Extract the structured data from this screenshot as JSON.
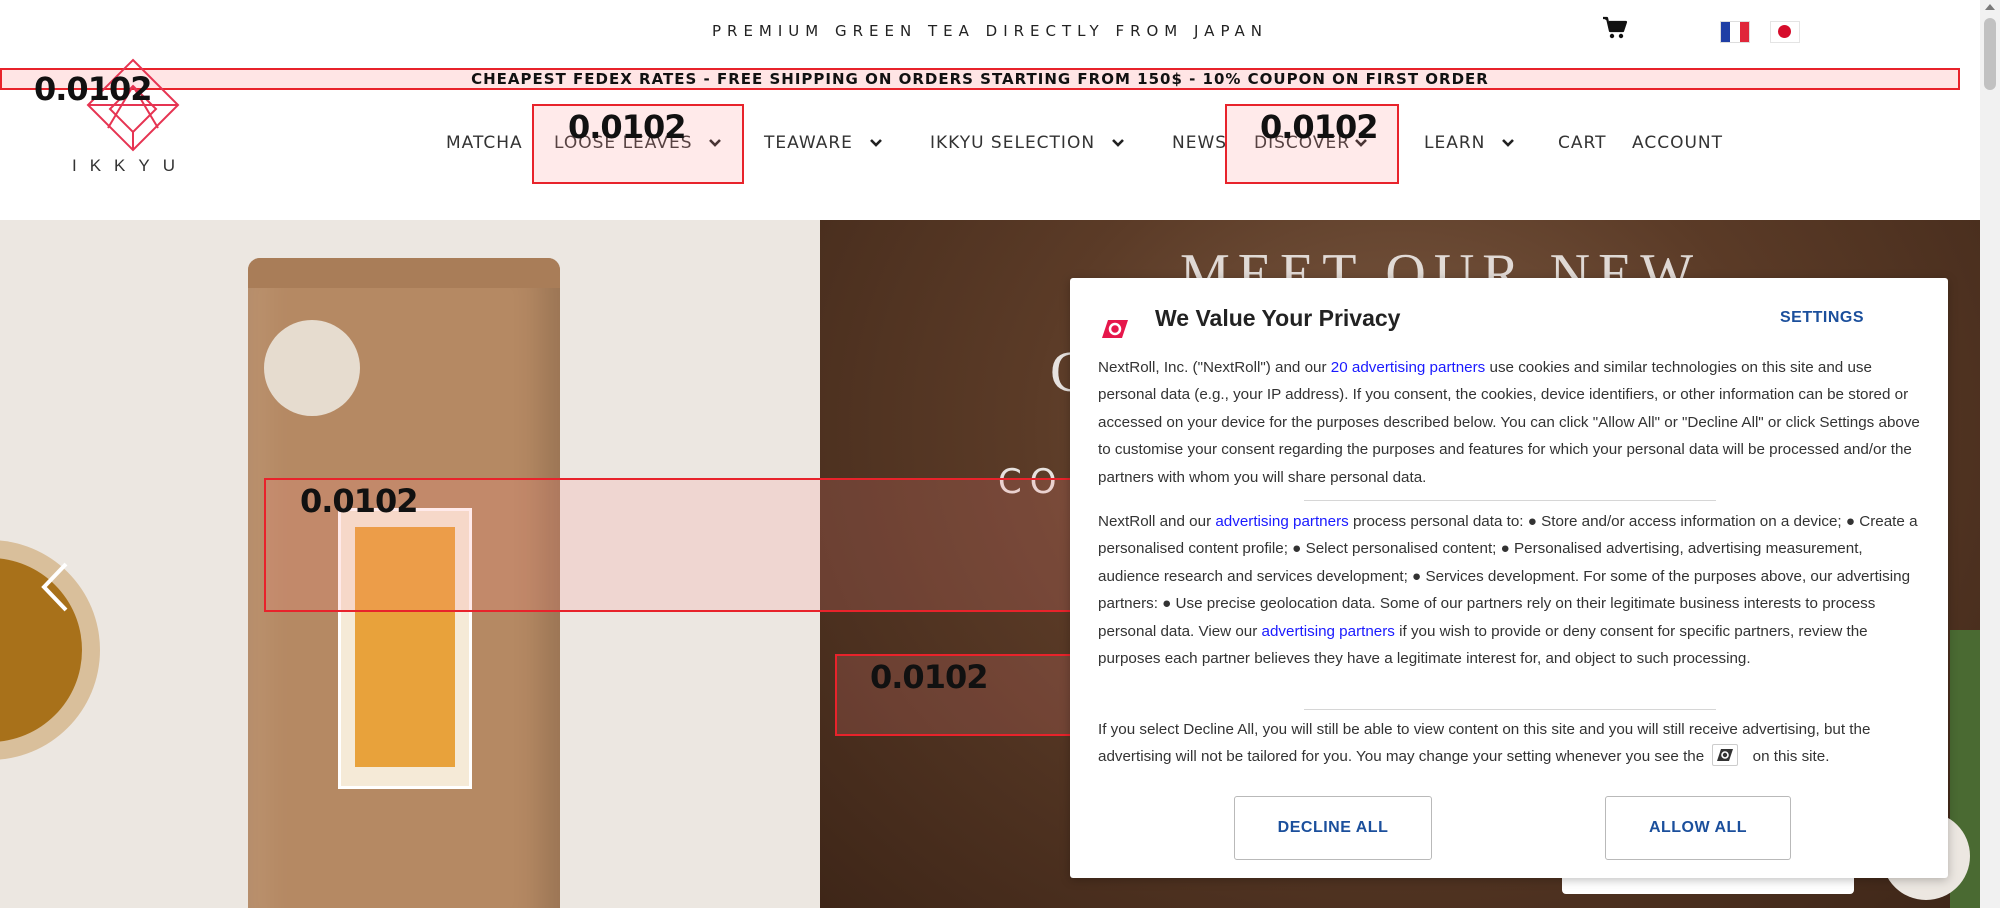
{
  "header": {
    "tagline": "PREMIUM GREEN TEA DIRECTLY FROM JAPAN",
    "cart_icon": "shopping-cart-icon",
    "languages": [
      "fr-flag",
      "jp-flag"
    ],
    "promo": "CHEAPEST FEDEX RATES - FREE SHIPPING ON ORDERS STARTING FROM 150$ - 10% COUPON ON FIRST ORDER",
    "logo_text": "IKKYU"
  },
  "nav": {
    "items": [
      {
        "label": "MATCHA",
        "dropdown": false
      },
      {
        "label": "LOOSE LEAVES",
        "dropdown": true
      },
      {
        "label": "TEAWARE",
        "dropdown": true
      },
      {
        "label": "IKKYU SELECTION",
        "dropdown": true
      },
      {
        "label": "NEWS",
        "dropdown": false
      },
      {
        "label": "DISCOVER",
        "dropdown": true
      },
      {
        "label": "LEARN",
        "dropdown": true
      },
      {
        "label": "CART",
        "dropdown": false
      },
      {
        "label": "ACCOUNT",
        "dropdown": false
      }
    ]
  },
  "overlay_labels": {
    "logo": "0.0102",
    "loose_leaves": "0.0102",
    "discover": "0.0102",
    "hero_left": "0.0102",
    "hero_center": "0.0102"
  },
  "hero": {
    "heading": "MEET OUR NEW",
    "line2_initial": "C",
    "subline": "CO",
    "prev_icon": "chevron-left-icon"
  },
  "privacy": {
    "title": "We Value Your Privacy",
    "settings_label": "SETTINGS",
    "para1": {
      "pre": "NextRoll, Inc. (\"NextRoll\") and our ",
      "link": "20 advertising partners",
      "post": " use cookies and similar technologies on this site and use personal data (e.g., your IP address). If you consent, the cookies, device identifiers, or other information can be stored or accessed on your device for the purposes described below. You can click \"Allow All\" or \"Decline All\" or click Settings above to customise your consent regarding the purposes and features for which your personal data will be processed and/or the partners with whom you will share personal data."
    },
    "para2": {
      "pre": "NextRoll and our ",
      "link1": "advertising partners",
      "mid": " process personal data to: ● Store and/or access information on a device; ● Create a personalised content profile; ● Select personalised content; ● Personalised advertising, advertising measurement, audience research and services development; ● Services development. For some of the purposes above, our advertising partners: ● Use precise geolocation data. Some of our partners rely on their legitimate business interests to process personal data. View our ",
      "link2": "advertising partners",
      "post": " if you wish to provide or deny consent for specific partners, review the purposes each partner believes they have a legitimate interest for, and object to such processing."
    },
    "para3": {
      "pre": "If you select Decline All, you will still be able to view content on this site and you will still receive advertising, but the advertising will not be tailored for you. You may change your setting whenever you see the ",
      "post": " on this site."
    },
    "decline_label": "DECLINE ALL",
    "allow_label": "ALLOW ALL"
  },
  "colors": {
    "overlay_red": "#e8232b",
    "privacy_button_text": "#1b4f9c",
    "link": "#1a1aff",
    "brand_red": "#e63452"
  }
}
